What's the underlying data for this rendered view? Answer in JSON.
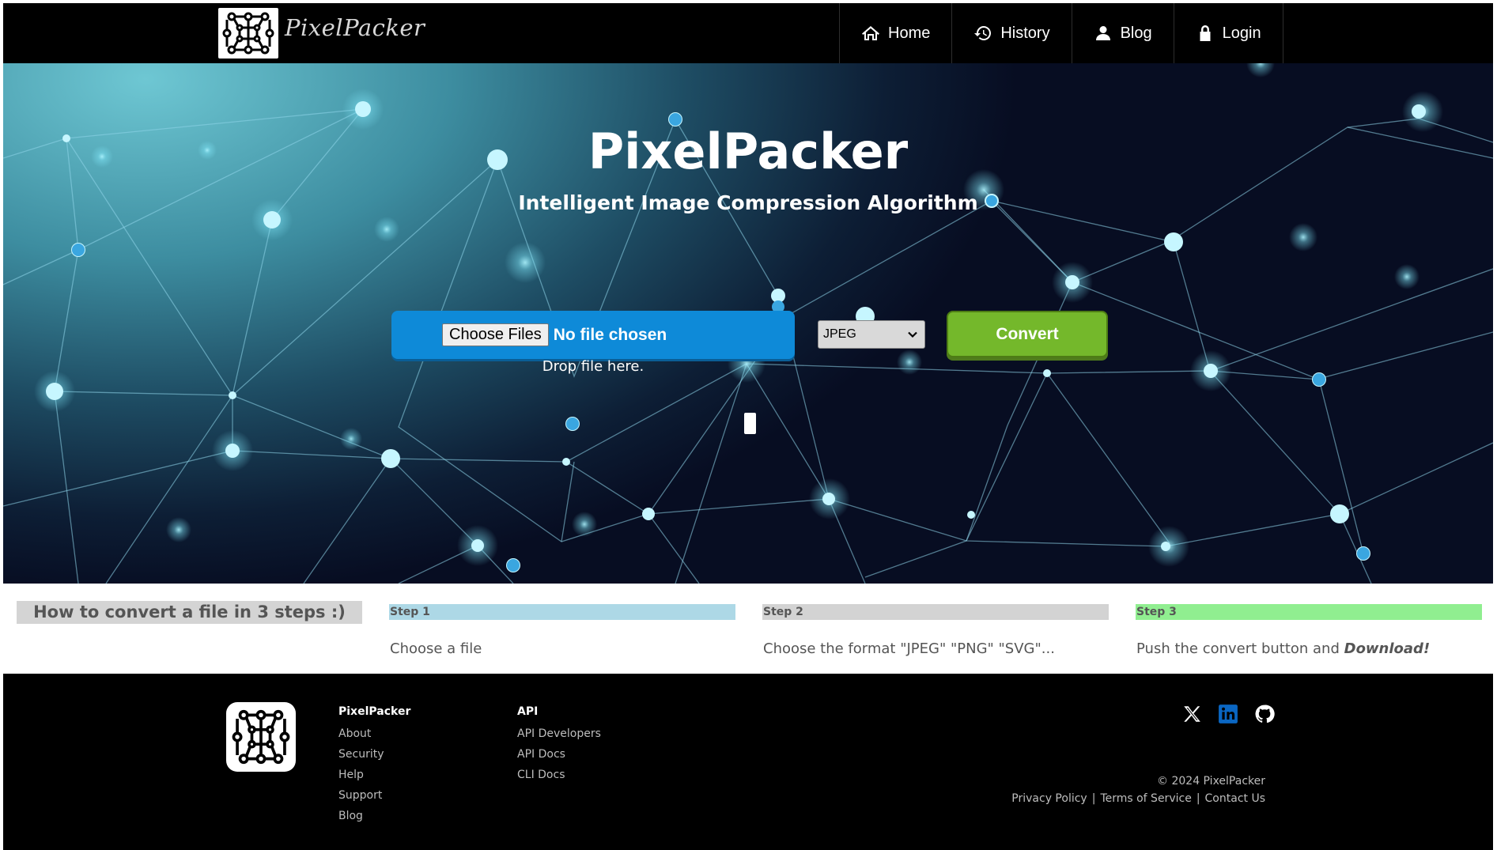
{
  "nav": {
    "brand": "PixelPacker",
    "logo_icon": "circuit-grid-logo",
    "items": [
      {
        "label": "Home",
        "icon": "home-icon"
      },
      {
        "label": "History",
        "icon": "history-icon"
      },
      {
        "label": "Blog",
        "icon": "user-icon"
      },
      {
        "label": "Login",
        "icon": "lock-icon"
      }
    ]
  },
  "hero": {
    "title": "PixelPacker",
    "subtitle": "Intelligent Image Compression Algorithm",
    "choose_files_label": "Choose Files",
    "no_file_text": "No file chosen",
    "drop_text": "Drop file here.",
    "format_selected": "JPEG",
    "convert_label": "Convert"
  },
  "steps": {
    "title": "How to convert a file in 3 steps :)",
    "items": [
      {
        "label": "Step 1",
        "text": "Choose a file",
        "color": "#add8e6"
      },
      {
        "label": "Step 2",
        "text": "Choose the format \"JPEG\" \"PNG\" \"SVG\"...",
        "color": "#d3d3d3"
      },
      {
        "label": "Step 3",
        "text": "Push the convert button and ",
        "emphasis": "Download!",
        "color": "#90ee90"
      }
    ]
  },
  "footer": {
    "columns": [
      {
        "heading": "PixelPacker",
        "links": [
          "About",
          "Security",
          "Help",
          "Support",
          "Blog"
        ]
      },
      {
        "heading": "API",
        "links": [
          "API Developers",
          "API Docs",
          "CLI Docs"
        ]
      }
    ],
    "social": [
      "x-icon",
      "linkedin-icon",
      "github-icon"
    ],
    "copyright": "© 2024 PixelPacker",
    "legal": [
      "Privacy Policy",
      "Terms of Service",
      "Contact Us"
    ],
    "legal_separator": "|"
  },
  "colors": {
    "nav_bg": "#000000",
    "upload_blue": "#0e8ad8",
    "convert_green": "#74b82b",
    "linkedin_blue": "#0a66c2"
  }
}
